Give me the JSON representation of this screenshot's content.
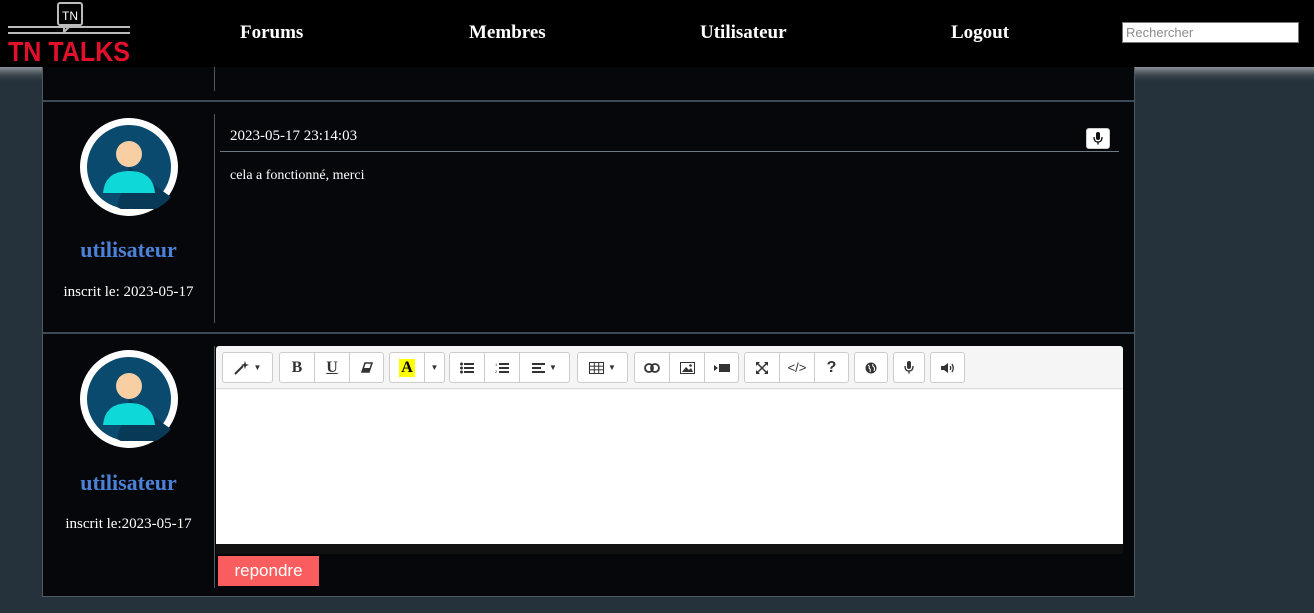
{
  "header": {
    "logo_badge": "TN",
    "logo_text": "TN TALKS",
    "nav": [
      "Forums",
      "Membres",
      "Utilisateur",
      "Logout"
    ],
    "search_placeholder": "Rechercher"
  },
  "colors": {
    "accent": "#4b82d8",
    "brand_red": "#e3102b",
    "reply": "#f95d5d"
  },
  "post": {
    "username": "utilisateur",
    "joined": "inscrit le: 2023-05-17",
    "timestamp": "2023-05-17 23:14:03",
    "body": "cela a fonctionné, merci"
  },
  "reply_form": {
    "username": "utilisateur",
    "joined": "inscrit le:2023-05-17",
    "submit_label": "repondre",
    "toolbar_icons": [
      "magic-icon",
      "bold-icon",
      "underline-icon",
      "eraser-icon",
      "text-color-icon",
      "unordered-list-icon",
      "ordered-list-icon",
      "align-icon",
      "table-icon",
      "link-icon",
      "image-icon",
      "video-icon",
      "fullscreen-icon",
      "code-view-icon",
      "help-icon",
      "globe-icon",
      "microphone-icon",
      "speaker-icon"
    ]
  }
}
